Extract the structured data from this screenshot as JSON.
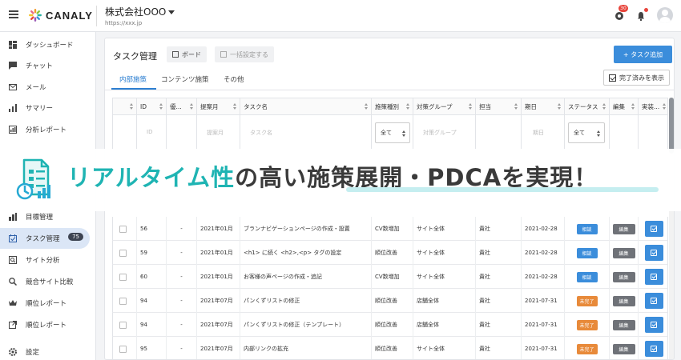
{
  "topbar": {
    "logo_text": "CANALY",
    "company": "株式会社OOO",
    "company_url": "https://xxx.jp",
    "notification_count": "30"
  },
  "sidebar": {
    "items": [
      {
        "label": "ダッシュボード",
        "icon": "dashboard-icon"
      },
      {
        "label": "チャット",
        "icon": "chat-icon"
      },
      {
        "label": "メール",
        "icon": "mail-icon"
      },
      {
        "label": "サマリー",
        "icon": "summary-icon"
      },
      {
        "label": "分析レポート",
        "icon": "report-icon"
      },
      {
        "label": "目標管理",
        "icon": "goal-icon"
      },
      {
        "label": "タスク管理",
        "icon": "task-icon",
        "count": "75",
        "active": true
      },
      {
        "label": "サイト分析",
        "icon": "site-analysis-icon"
      },
      {
        "label": "競合サイト比較",
        "icon": "competitor-icon"
      },
      {
        "label": "順位レポート",
        "icon": "crown-icon"
      },
      {
        "label": "順位レポート",
        "icon": "external-link-icon"
      },
      {
        "label": "設定",
        "icon": "gear-icon"
      }
    ]
  },
  "main": {
    "title": "タスク管理",
    "board_label": "ボード",
    "bulk_label": "一括設定する",
    "add_label": "+ タスク追加",
    "tabs": [
      "内部施策",
      "コンテンツ施策",
      "その他"
    ],
    "show_done_label": "完了済みを表示",
    "columns": [
      "ID",
      "優...",
      "提案月",
      "タスク名",
      "施策種別",
      "対策グループ",
      "担当",
      "期日",
      "ステータス",
      "編集",
      "実装..."
    ],
    "filters": {
      "id": "ID",
      "month": "提案月",
      "task": "タスク名",
      "type": "全て",
      "group": "対策グループ",
      "due": "期日",
      "status": "全て"
    },
    "rows": [
      {
        "id": "56",
        "priority": "-",
        "month": "2021年01月",
        "task": "ブランナビゲーションページの作成・設置",
        "type": "CV数増加",
        "group": "サイト全体",
        "owner": "貴社",
        "due": "2021-02-28",
        "status": "相談",
        "status_color": "blue"
      },
      {
        "id": "59",
        "priority": "-",
        "month": "2021年01月",
        "task": "<h1> に続く <h2>,<p> タグの設定",
        "type": "順位改善",
        "group": "サイト全体",
        "owner": "貴社",
        "due": "2021-02-28",
        "status": "相談",
        "status_color": "blue"
      },
      {
        "id": "60",
        "priority": "-",
        "month": "2021年01月",
        "task": "お客様の声ページの作成・追記",
        "type": "CV数増加",
        "group": "サイト全体",
        "owner": "貴社",
        "due": "2021-02-28",
        "status": "相談",
        "status_color": "blue"
      },
      {
        "id": "94",
        "priority": "-",
        "month": "2021年07月",
        "task": "パンくずリストの修正",
        "type": "順位改善",
        "group": "店舗全体",
        "owner": "貴社",
        "due": "2021-07-31",
        "status": "未完了",
        "status_color": "orange"
      },
      {
        "id": "94",
        "priority": "-",
        "month": "2021年07月",
        "task": "パンくずリストの修正（テンプレート）",
        "type": "順位改善",
        "group": "店舗全体",
        "owner": "貴社",
        "due": "2021-07-31",
        "status": "未完了",
        "status_color": "orange"
      },
      {
        "id": "95",
        "priority": "-",
        "month": "2021年07月",
        "task": "内部リンクの拡充",
        "type": "順位改善",
        "group": "サイト全体",
        "owner": "貴社",
        "due": "2021-07-31",
        "status": "未完了",
        "status_color": "orange"
      }
    ],
    "edit_label": "編集"
  },
  "banner": {
    "part1": "リアルタイム性",
    "part2": "の高い",
    "part3": "施策展開・PDCAを実現！"
  },
  "colors": {
    "accent": "#3b8ddb",
    "teal": "#1fb4b3",
    "orange": "#e88a3a",
    "badge_red": "#e8453c"
  }
}
